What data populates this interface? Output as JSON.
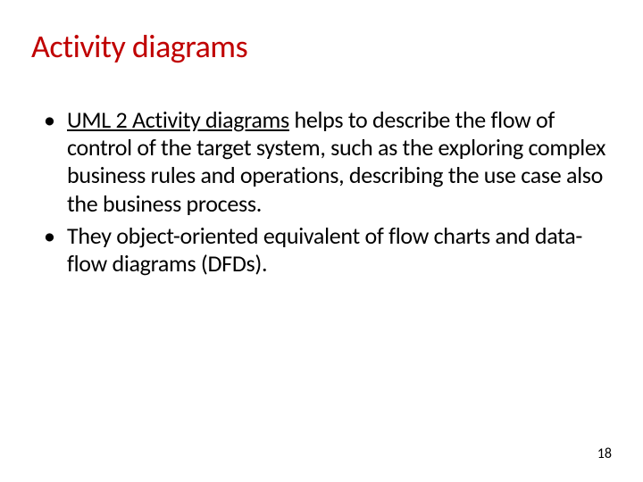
{
  "slide": {
    "title": "Activity diagrams",
    "bullets": [
      {
        "link_text": "UML 2 Activity diagrams",
        "rest_text": " helps to describe the flow of control of the target system, such as the exploring complex business rules and operations, describing the use case also the business process."
      },
      {
        "text": "They object-oriented equivalent of flow charts and data-flow diagrams (DFDs)."
      }
    ],
    "page_number": "18"
  }
}
